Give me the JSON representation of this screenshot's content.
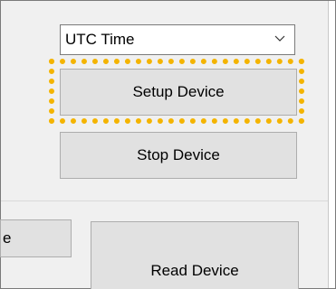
{
  "time_mode_select": {
    "value": "UTC Time",
    "icon": "chevron-down-icon"
  },
  "buttons": {
    "setup_device": "Setup Device",
    "stop_device": "Stop Device",
    "partial_label": "e",
    "read_device": "Read Device"
  },
  "highlight": {
    "target": "Setup Device",
    "color": "#f4b400"
  }
}
